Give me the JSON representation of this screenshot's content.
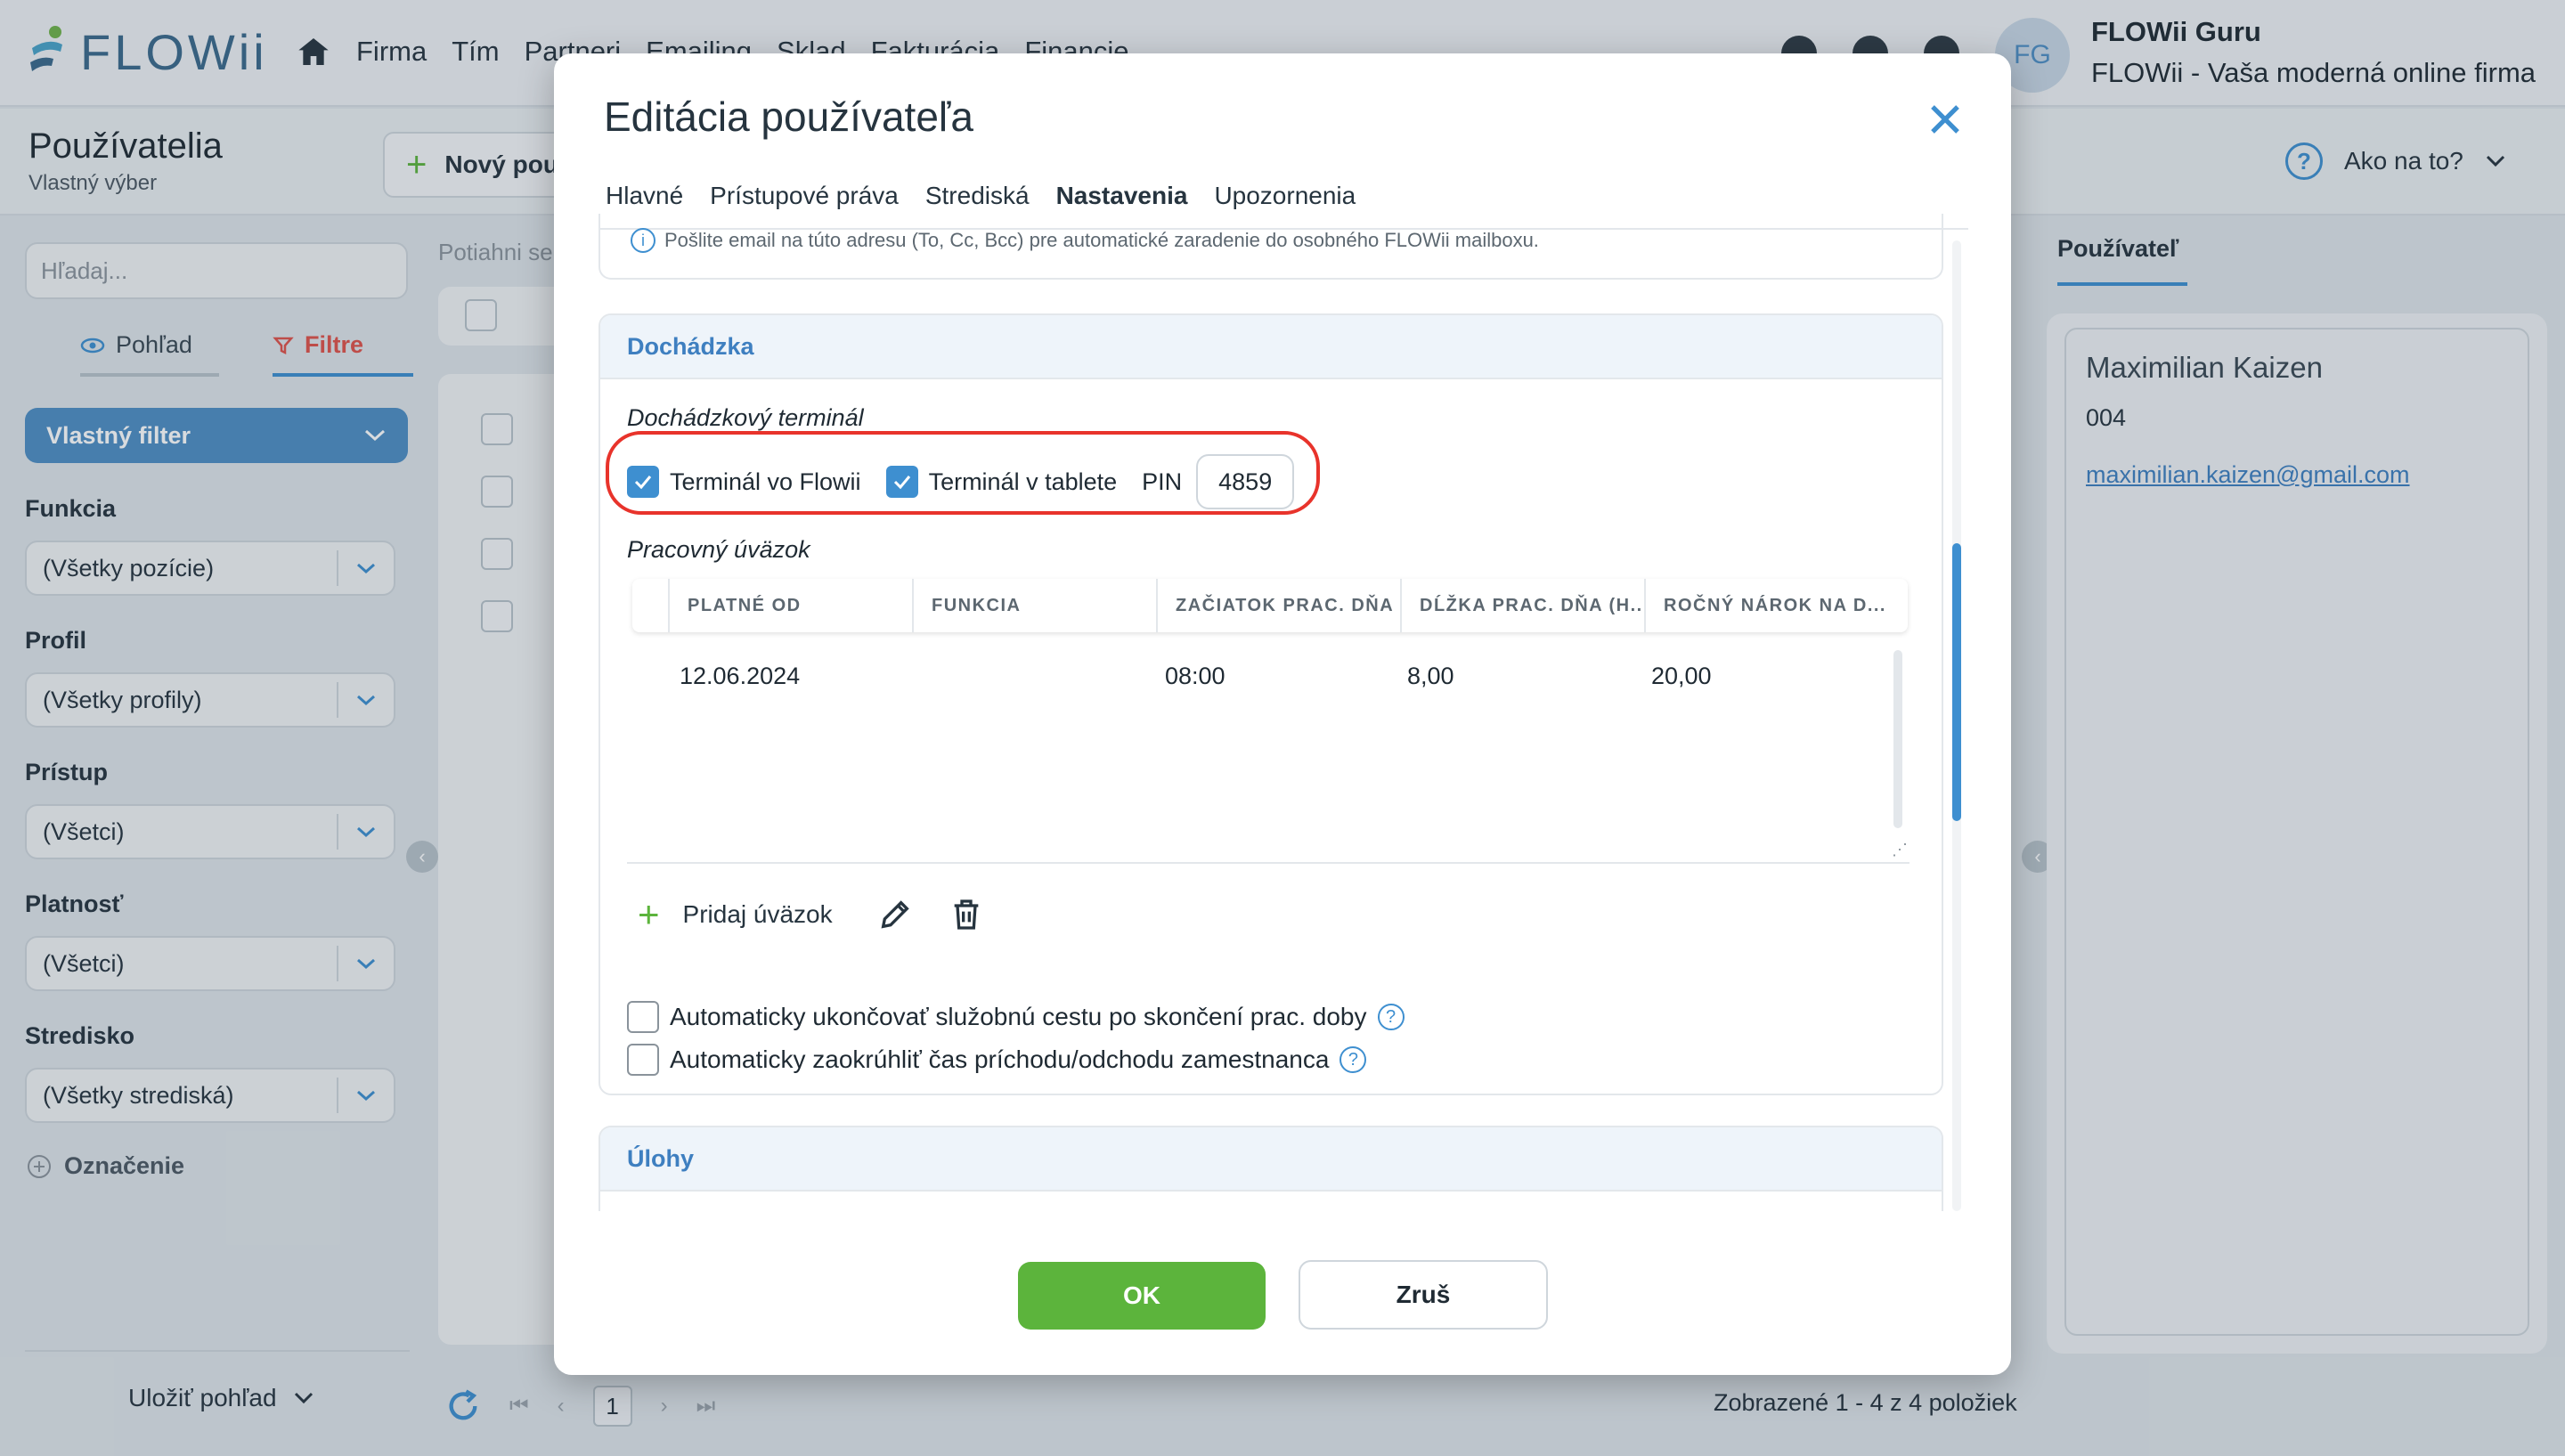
{
  "app": {
    "logo_text": "FLOWii",
    "nav": [
      "Firma",
      "Tím",
      "Partneri",
      "Emailing",
      "Sklad",
      "Fakturácia",
      "Financie"
    ],
    "avatar_initials": "FG",
    "user_name": "FLOWii Guru",
    "user_company": "FLOWii - Vaša moderná online firma"
  },
  "page": {
    "title": "Používatelia",
    "subtitle": "Vlastný výber",
    "new_button": "Nový pou",
    "help_label": "Ako na to?",
    "drag_hint": "Potiahni se"
  },
  "sidebar": {
    "search_placeholder": "Hľadaj...",
    "tab_view": "Pohľad",
    "tab_filters": "Filtre",
    "custom_filter": "Vlastný filter",
    "filters": [
      {
        "label": "Funkcia",
        "value": "(Všetky pozície)"
      },
      {
        "label": "Profil",
        "value": "(Všetky profily)"
      },
      {
        "label": "Prístup",
        "value": "(Všetci)"
      },
      {
        "label": "Platnosť",
        "value": "(Všetci)"
      },
      {
        "label": "Stredisko",
        "value": "(Všetky strediská)"
      }
    ],
    "tag_label": "Označenie",
    "save_view": "Uložiť pohľad"
  },
  "pager": {
    "current_page": "1",
    "summary": "Zobrazené 1 - 4 z 4 položiek"
  },
  "right_panel": {
    "tab": "Používateľ",
    "name": "Maximilian Kaizen",
    "number": "004",
    "email": "maximilian.kaizen@gmail.com"
  },
  "modal": {
    "title": "Editácia používateľa",
    "tabs": [
      "Hlavné",
      "Prístupové práva",
      "Strediská",
      "Nastavenia",
      "Upozornenia"
    ],
    "active_tab": "Nastavenia",
    "info_text": "Pošlite email na túto adresu (To, Cc, Bcc) pre automatické zaradenie do osobného FLOWii mailboxu.",
    "attendance": {
      "section_title": "Dochádzka",
      "terminal_label": "Dochádzkový terminál",
      "terminal_flowii": "Terminál vo Flowii",
      "terminal_flowii_checked": true,
      "terminal_tablet": "Terminál v tablete",
      "terminal_tablet_checked": true,
      "pin_label": "PIN",
      "pin_value": "4859",
      "workload_label": "Pracovný úväzok",
      "columns": [
        "PLATNÉ OD",
        "FUNKCIA",
        "ZAČIATOK PRAC. DŇA",
        "DĹŽKA PRAC. DŇA (H...",
        "ROČNÝ NÁROK NA D..."
      ],
      "rows": [
        {
          "platne_od": "12.06.2024",
          "funkcia": "",
          "zaciatok": "08:00",
          "dlzka": "8,00",
          "narok": "20,00"
        }
      ],
      "add_workload": "Pridaj úväzok",
      "option_trip": "Automaticky ukončovať služobnú cestu po skončení prac. doby",
      "option_round": "Automaticky zaokrúhliť čas príchodu/odchodu zamestnanca"
    },
    "tasks_title": "Úlohy",
    "ok_label": "OK",
    "cancel_label": "Zruš"
  },
  "colors": {
    "accent": "#3e8fd0",
    "ok_green": "#5cb43c",
    "highlight_red": "#e8332b",
    "filter_red": "#e0524a"
  }
}
